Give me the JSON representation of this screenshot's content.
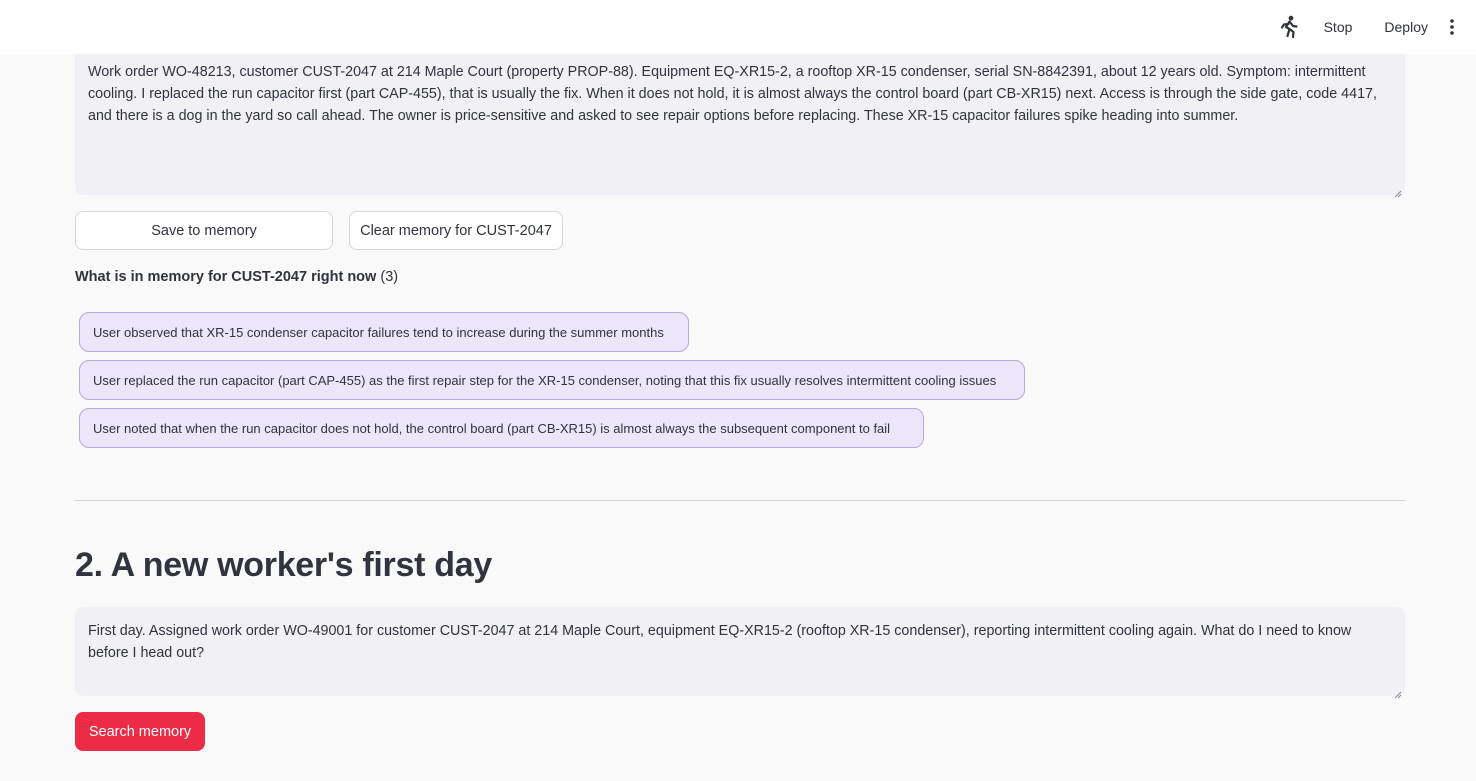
{
  "toolbar": {
    "running_icon": "running-man-icon",
    "stop_label": "Stop",
    "deploy_label": "Deploy",
    "menu_icon": "vertical-dots-icon"
  },
  "work_order_input": {
    "value": "Work order WO-48213, customer CUST-2047 at 214 Maple Court (property PROP-88). Equipment EQ-XR15-2, a rooftop XR-15 condenser, serial SN-8842391, about 12 years old. Symptom: intermittent cooling. I replaced the run capacitor first (part CAP-455), that is usually the fix. When it does not hold, it is almost always the control board (part CB-XR15) next. Access is through the side gate, code 4417, and there is a dog in the yard so call ahead. The owner is price-sensitive and asked to see repair options before replacing. These XR-15 capacitor failures spike heading into summer."
  },
  "memory_actions": {
    "save_label": "Save to memory",
    "clear_label": "Clear memory for CUST-2047"
  },
  "memory": {
    "heading": "What is in memory for CUST-2047 right now",
    "count": "(3)",
    "items": [
      "User observed that XR-15 condenser capacitor failures tend to increase during the summer months",
      "User replaced the run capacitor (part CAP-455) as the first repair step for the XR-15 condenser, noting that this fix usually resolves intermittent cooling issues",
      "User noted that when the run capacitor does not hold, the control board (part CB-XR15) is almost always the subsequent component to fail"
    ]
  },
  "section2": {
    "title": "2. A new worker's first day",
    "query_value": "First day. Assigned work order WO-49001 for customer CUST-2047 at 214 Maple Court, equipment EQ-XR15-2 (rooftop XR-15 condenser), reporting intermittent cooling again. What do I need to know before I head out?",
    "search_label": "Search memory"
  },
  "colors": {
    "primary": "#ec2b46",
    "chip_bg": "#ece6fb",
    "chip_border": "#b9a6e8",
    "input_bg": "#f0f0f5"
  }
}
